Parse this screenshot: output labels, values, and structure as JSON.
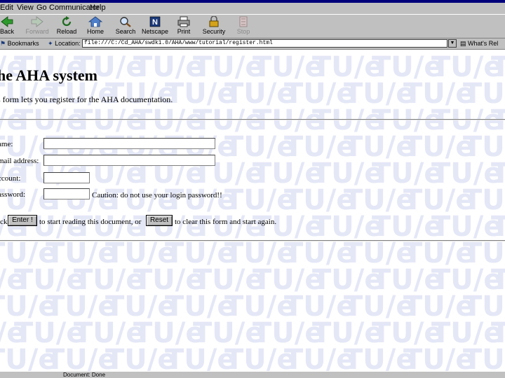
{
  "menu": [
    "Edit",
    "View",
    "Go",
    "Communicator",
    "Help"
  ],
  "toolbar": [
    {
      "label": "Back",
      "icon": "back-arrow-icon",
      "enabled": true
    },
    {
      "label": "Forward",
      "icon": "forward-arrow-icon",
      "enabled": false
    },
    {
      "label": "Reload",
      "icon": "reload-icon",
      "enabled": true
    },
    {
      "label": "Home",
      "icon": "home-icon",
      "enabled": true
    },
    {
      "label": "Search",
      "icon": "search-icon",
      "enabled": true
    },
    {
      "label": "Netscape",
      "icon": "netscape-icon",
      "enabled": true
    },
    {
      "label": "Print",
      "icon": "print-icon",
      "enabled": true
    },
    {
      "label": "Security",
      "icon": "security-lock-icon",
      "enabled": true
    },
    {
      "label": "Stop",
      "icon": "stop-icon",
      "enabled": false
    }
  ],
  "location": {
    "bookmarks_label": "Bookmarks",
    "location_label": "Location:",
    "url": "file:///C:/Cd_AHA/swdk1.0/AHA/www/tutorial/register.html",
    "whats_related": "What's Rel"
  },
  "page": {
    "title": "he AHA system",
    "intro": "s form lets you register for the AHA documentation.",
    "fields": [
      {
        "label": "ame:",
        "value": ""
      },
      {
        "label": "mail address:",
        "value": ""
      },
      {
        "label": "ccount:",
        "value": ""
      },
      {
        "label": "assword:",
        "value": ""
      }
    ],
    "caution": "Caution: do not use your login password!!",
    "action_pre": "ick",
    "enter_button": "Enter !",
    "action_mid": "to start reading this document, or",
    "reset_button": "Reset",
    "action_post": "to clear this form and start again."
  },
  "watermark_text": "TU/e",
  "status": "Document: Done",
  "colors": {
    "chrome": "#c0c0c0",
    "titlebar": "#00007b",
    "watermark": "#e4e7f6"
  }
}
